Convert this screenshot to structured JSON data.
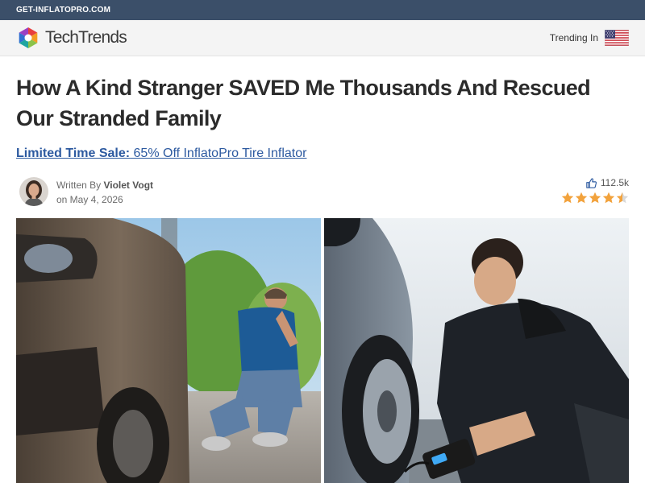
{
  "topbar": {
    "domain": "GET-INFLATOPRO.COM"
  },
  "header": {
    "brand_name": "TechTrends",
    "logo_icon": "rainbow-aperture-logo-icon",
    "trending_label": "Trending In",
    "flag_icon": "us-flag-icon"
  },
  "article": {
    "headline": "How A Kind Stranger SAVED Me Thousands And Rescued Our Stranded Family",
    "promo_bold": "Limited Time Sale:",
    "promo_text": " 65% Off InflatoPro Tire Inflator",
    "byline": {
      "written_by_label": "Written By ",
      "author": "Violet Vogt",
      "date": "on May 4, 2026"
    },
    "stats": {
      "likes": "112.5k",
      "rating": 4.5,
      "rating_max": 5
    },
    "images": {
      "left_icon": "stranded-driver-photo",
      "right_icon": "inflating-tire-photo"
    }
  },
  "colors": {
    "topbar_bg": "#3b4f69",
    "link": "#2d5aa0",
    "star": "#f2a23c"
  }
}
